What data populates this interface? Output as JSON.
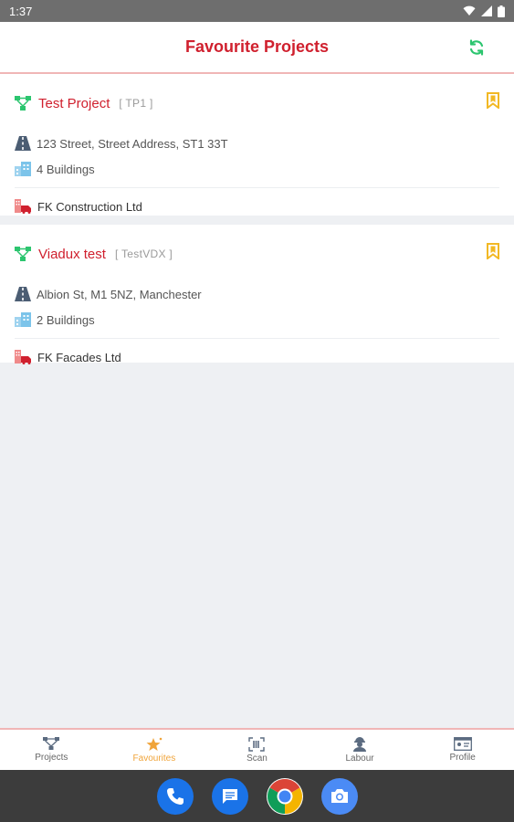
{
  "status": {
    "time": "1:37"
  },
  "header": {
    "title": "Favourite Projects"
  },
  "projects": [
    {
      "name": "Test Project",
      "code": "[ TP1 ]",
      "address": "123 Street, Street Address, ST1 33T",
      "buildings": "4 Buildings",
      "company": "FK Construction Ltd"
    },
    {
      "name": "Viadux test",
      "code": "[ TestVDX ]",
      "address": "Albion St, M1 5NZ, Manchester",
      "buildings": "2 Buildings",
      "company": "FK Facades Ltd"
    }
  ],
  "nav": {
    "items": [
      {
        "label": "Projects",
        "icon": "projects-icon"
      },
      {
        "label": "Favourites",
        "icon": "star-icon"
      },
      {
        "label": "Scan",
        "icon": "scan-icon"
      },
      {
        "label": "Labour",
        "icon": "worker-icon"
      },
      {
        "label": "Profile",
        "icon": "profile-card-icon"
      }
    ],
    "active_color": "#f0a43a"
  },
  "colors": {
    "accent": "#d0202e",
    "bookmark": "#f2b824",
    "refresh": "#2cc56f",
    "project_icon": "#2cc56f"
  },
  "dock": [
    "phone-icon",
    "messages-icon",
    "chrome-icon",
    "camera-icon"
  ]
}
